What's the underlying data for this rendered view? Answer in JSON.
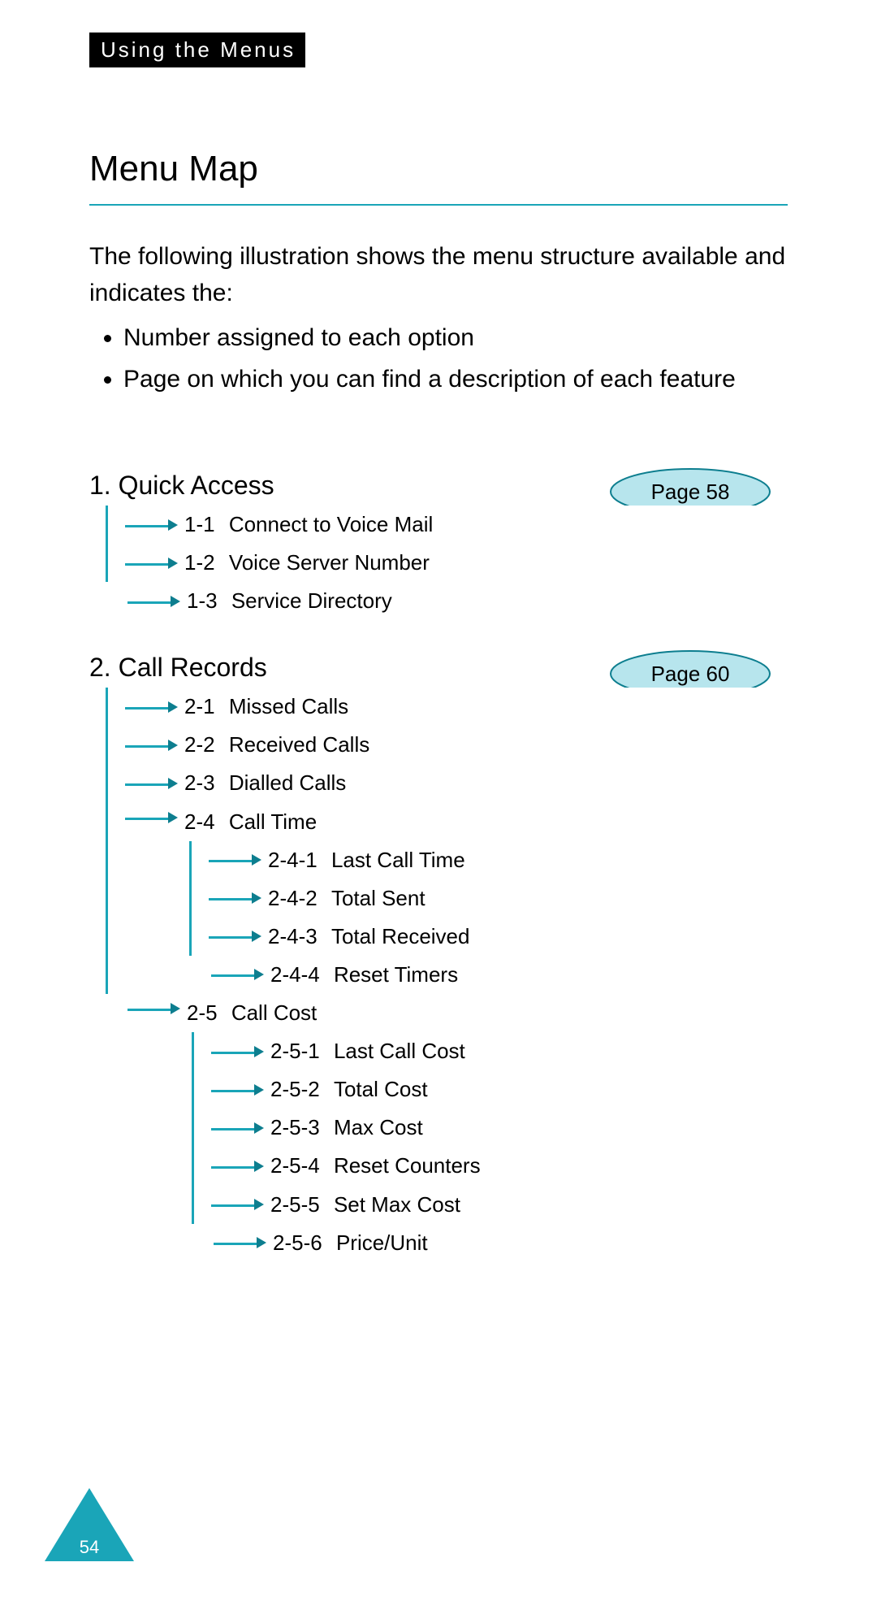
{
  "header_tag": "Using the Menus",
  "title": "Menu Map",
  "intro": "The following illustration shows the menu structure available and indicates the:",
  "bullets": [
    "Number assigned to each option",
    "Page on which you can find a description of each feature"
  ],
  "sections": [
    {
      "title": "1. Quick Access",
      "page_ref": "Page 58",
      "items": [
        {
          "num": "1-1",
          "label": "Connect to Voice Mail"
        },
        {
          "num": "1-2",
          "label": "Voice Server Number"
        },
        {
          "num": "1-3",
          "label": "Service Directory"
        }
      ]
    },
    {
      "title": "2. Call Records",
      "page_ref": "Page 60",
      "items": [
        {
          "num": "2-1",
          "label": "Missed Calls"
        },
        {
          "num": "2-2",
          "label": "Received Calls"
        },
        {
          "num": "2-3",
          "label": "Dialled Calls"
        },
        {
          "num": "2-4",
          "label": "Call Time",
          "children": [
            {
              "num": "2-4-1",
              "label": "Last Call Time"
            },
            {
              "num": "2-4-2",
              "label": "Total Sent"
            },
            {
              "num": "2-4-3",
              "label": "Total Received"
            },
            {
              "num": "2-4-4",
              "label": "Reset Timers"
            }
          ]
        },
        {
          "num": "2-5",
          "label": "Call Cost",
          "children": [
            {
              "num": "2-5-1",
              "label": "Last Call Cost"
            },
            {
              "num": "2-5-2",
              "label": "Total Cost"
            },
            {
              "num": "2-5-3",
              "label": "Max Cost"
            },
            {
              "num": "2-5-4",
              "label": "Reset Counters"
            },
            {
              "num": "2-5-5",
              "label": "Set Max Cost"
            },
            {
              "num": "2-5-6",
              "label": "Price/Unit"
            }
          ]
        }
      ]
    }
  ],
  "page_number": "54"
}
